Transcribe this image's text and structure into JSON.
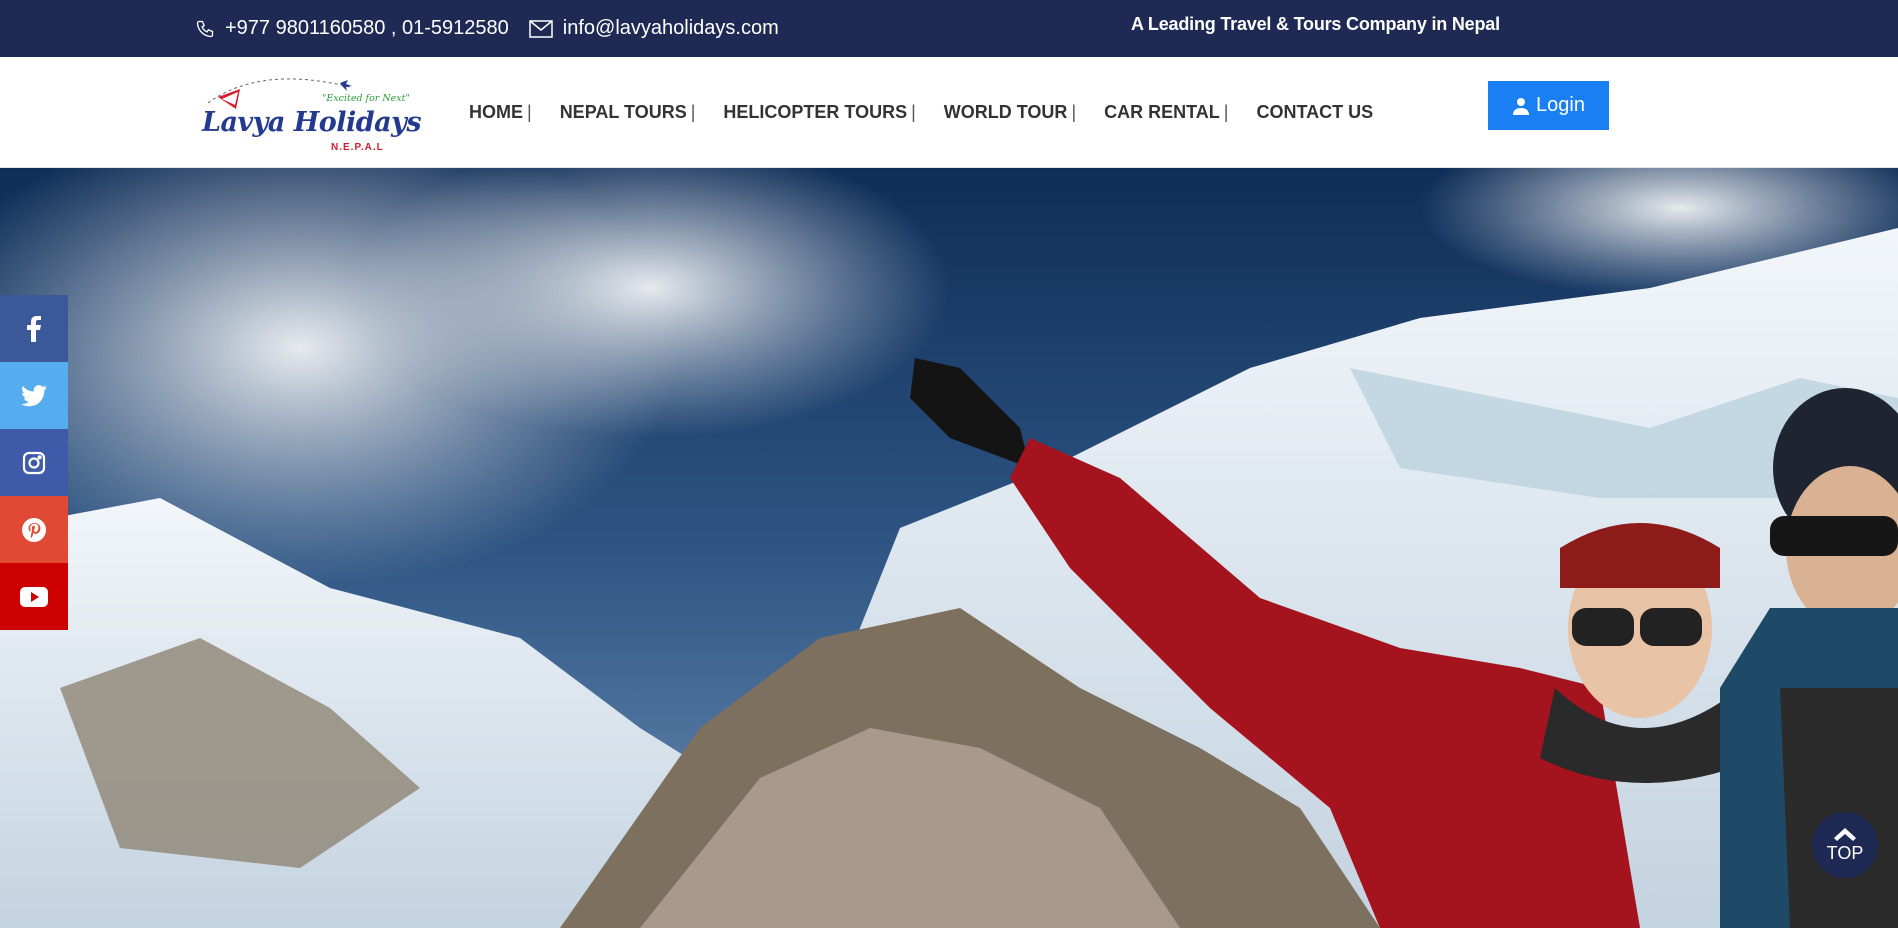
{
  "topbar": {
    "phone": "+977 9801160580 , 01-5912580",
    "phone_icon": "phone-icon",
    "email": "info@lavyaholidays.com",
    "email_icon": "envelope-icon",
    "tagline": "A Leading Travel & Tours Company in Nepal"
  },
  "logo": {
    "brand": "Lavya Holidays",
    "slogan": "\"Excited for Next\"",
    "sub": "N.E.P.A.L"
  },
  "nav": {
    "items": [
      {
        "label": "HOME",
        "sep": "|"
      },
      {
        "label": "NEPAL TOURS",
        "sep": "|"
      },
      {
        "label": "HELICOPTER TOURS",
        "sep": "|"
      },
      {
        "label": "WORLD TOUR",
        "sep": "|"
      },
      {
        "label": "CAR RENTAL",
        "sep": "|"
      },
      {
        "label": "CONTACT US",
        "sep": ""
      }
    ]
  },
  "login": {
    "label": "Login",
    "icon": "user-icon",
    "color": "#1a7ff2"
  },
  "social": [
    {
      "icon": "facebook-icon",
      "color": "#3b5998"
    },
    {
      "icon": "twitter-icon",
      "color": "#55acee"
    },
    {
      "icon": "instagram-icon",
      "color": "#3f5aa8"
    },
    {
      "icon": "pinterest-icon",
      "color": "#e04a35"
    },
    {
      "icon": "youtube-icon",
      "color": "#cc0000"
    }
  ],
  "totop": {
    "label": "TOP",
    "icon": "chevron-up-icon"
  },
  "colors": {
    "topbar": "#1f2a54",
    "accent": "#1a7ff2"
  }
}
